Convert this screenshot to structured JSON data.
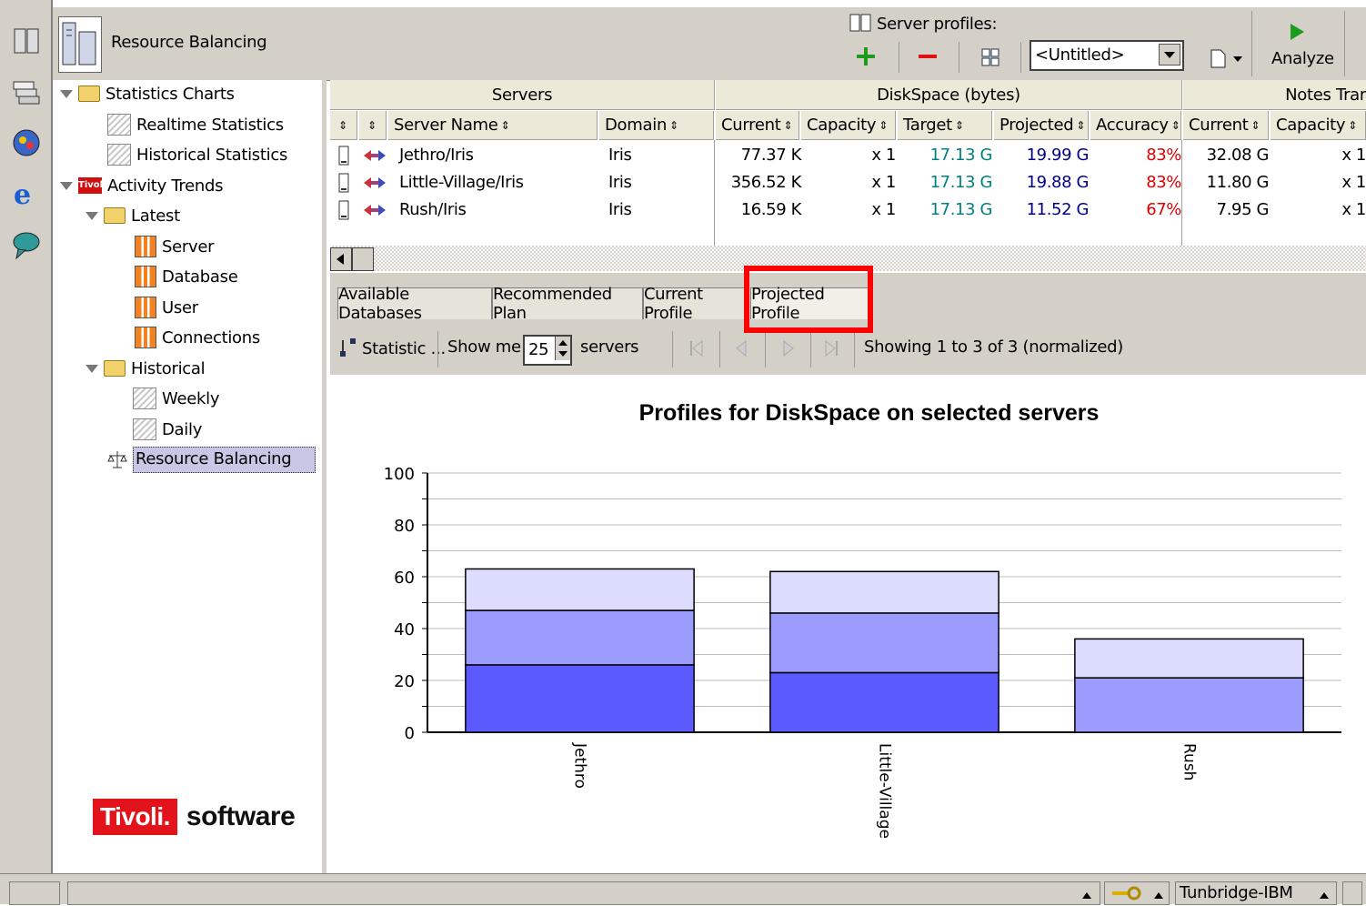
{
  "header": {
    "title": "Resource Balancing",
    "server_profiles_label": "Server profiles:",
    "profile_select_value": "<Untitled>",
    "analyze_label": "Analyze"
  },
  "tree": {
    "statistics_charts": "Statistics Charts",
    "realtime_statistics": "Realtime Statistics",
    "historical_statistics": "Historical Statistics",
    "activity_trends": "Activity Trends",
    "latest": "Latest",
    "server": "Server",
    "database": "Database",
    "user": "User",
    "connections": "Connections",
    "historical": "Historical",
    "weekly": "Weekly",
    "daily": "Daily",
    "resource_balancing": "Resource Balancing"
  },
  "brand": {
    "tivoli": "Tivoli.",
    "software": "software",
    "tivoli_color": "#e3131b"
  },
  "table": {
    "groups": {
      "servers": "Servers",
      "diskspace": "DiskSpace (bytes)",
      "notes": "Notes Trar"
    },
    "columns": {
      "server_name": "Server Name",
      "domain": "Domain",
      "current": "Current",
      "capacity": "Capacity",
      "target": "Target",
      "projected": "Projected",
      "accuracy": "Accuracy",
      "current2": "Current",
      "capacity2": "Capacity"
    },
    "rows": [
      {
        "server": "Jethro/Iris",
        "domain": "Iris",
        "current": "77.37 K",
        "capacity": "x 1",
        "target": "17.13 G",
        "projected": "19.99 G",
        "accuracy": "83%",
        "current2": "32.08 G",
        "capacity2": "x 1"
      },
      {
        "server": "Little-Village/Iris",
        "domain": "Iris",
        "current": "356.52 K",
        "capacity": "x 1",
        "target": "17.13 G",
        "projected": "19.88 G",
        "accuracy": "83%",
        "current2": "11.80 G",
        "capacity2": "x 1"
      },
      {
        "server": "Rush/Iris",
        "domain": "Iris",
        "current": "16.59 K",
        "capacity": "x 1",
        "target": "17.13 G",
        "projected": "11.52 G",
        "accuracy": "67%",
        "current2": "7.95 G",
        "capacity2": "x 1"
      }
    ],
    "colors": {
      "target": "#008080",
      "projected": "#00008b",
      "accuracy": "#e00000"
    }
  },
  "tabs": [
    "Available Databases",
    "Recommended Plan",
    "Current Profile",
    "Projected Profile"
  ],
  "toolbar": {
    "statistic_label": "Statistic ...",
    "show_me_label": "Show me",
    "show_me_value": "25",
    "servers_label": "servers",
    "showing_text": "Showing 1 to 3 of 3 (normalized)"
  },
  "chart_data": {
    "type": "bar",
    "stacked": true,
    "title": "Profiles for DiskSpace on selected servers",
    "categories": [
      "Jethro",
      "Little-Village",
      "Rush"
    ],
    "series": [
      {
        "color": "#5a5aff",
        "values": [
          26,
          23,
          0
        ]
      },
      {
        "color": "#9c9cff",
        "values": [
          21,
          23,
          21
        ]
      },
      {
        "color": "#dcdcff",
        "values": [
          16,
          16,
          15
        ]
      }
    ],
    "ylim": [
      0,
      100
    ],
    "yticks": [
      0,
      20,
      40,
      60,
      80,
      100
    ],
    "grid": true,
    "legend": "none"
  },
  "statusbar": {
    "server": "Tunbridge-IBM"
  },
  "highlight_color": "#ff0000"
}
